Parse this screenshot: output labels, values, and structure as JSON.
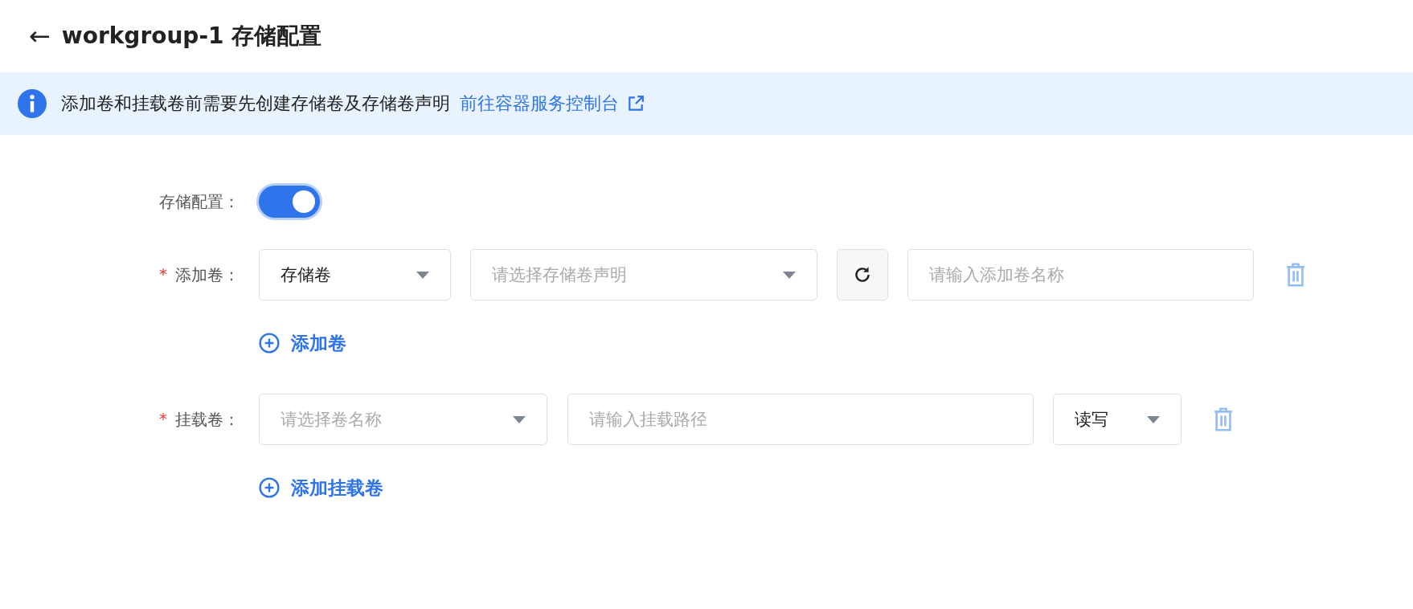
{
  "header": {
    "back_symbol": "←",
    "title": "workgroup-1 存储配置"
  },
  "notice": {
    "text": "添加卷和挂载卷前需要先创建存储卷及存储卷声明",
    "link": "前往容器服务控制台"
  },
  "storage_toggle": {
    "label": "存储配置：",
    "on": true
  },
  "volumes": {
    "label": "添加卷：",
    "required_mark": "*",
    "rows": [
      {
        "type_select": {
          "value": "存储卷"
        },
        "claim_select": {
          "placeholder": "请选择存储卷声明"
        },
        "name_input": {
          "placeholder": "请输入添加卷名称"
        }
      }
    ],
    "add_button": "添加卷"
  },
  "mounts": {
    "label": "挂载卷：",
    "required_mark": "*",
    "rows": [
      {
        "volume_select": {
          "placeholder": "请选择卷名称"
        },
        "path_input": {
          "placeholder": "请输入挂载路径"
        },
        "mode_select": {
          "value": "读写"
        }
      }
    ],
    "add_button": "添加挂载卷"
  }
}
